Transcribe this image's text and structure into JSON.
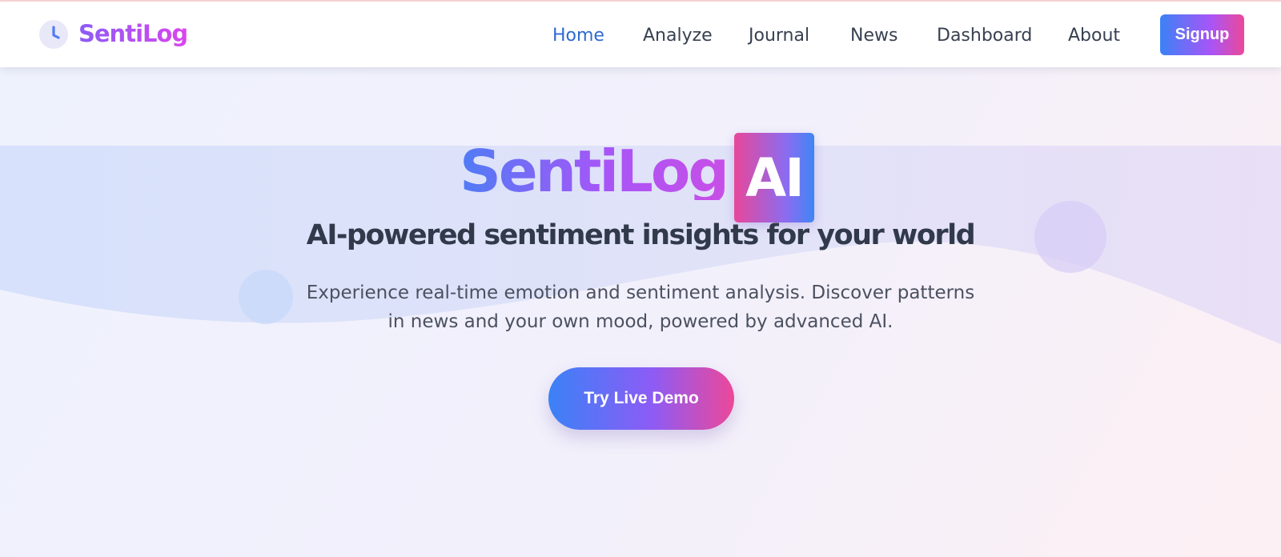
{
  "brand": {
    "name": "SentiLog",
    "logo_icon": "clock-icon"
  },
  "nav": {
    "items": [
      {
        "label": "Home",
        "active": true
      },
      {
        "label": "Analyze",
        "active": false
      },
      {
        "label": "Journal",
        "active": false
      },
      {
        "label": "News",
        "active": false
      },
      {
        "label": "Dashboard",
        "active": false
      },
      {
        "label": "About",
        "active": false
      }
    ],
    "signup_label": "Signup"
  },
  "hero": {
    "brand_text": "SentiLog",
    "badge_text": "AI",
    "tagline": "AI-powered sentiment insights for your world",
    "description": "Experience real-time emotion and sentiment analysis. Discover patterns in news and your own mood, powered by advanced AI.",
    "cta_label": "Try Live Demo"
  },
  "colors": {
    "accent_blue": "#3b82f6",
    "accent_purple": "#a855f7",
    "accent_pink": "#ec4899",
    "active_nav": "#2f6ad0",
    "text_dark": "#313a4b"
  }
}
